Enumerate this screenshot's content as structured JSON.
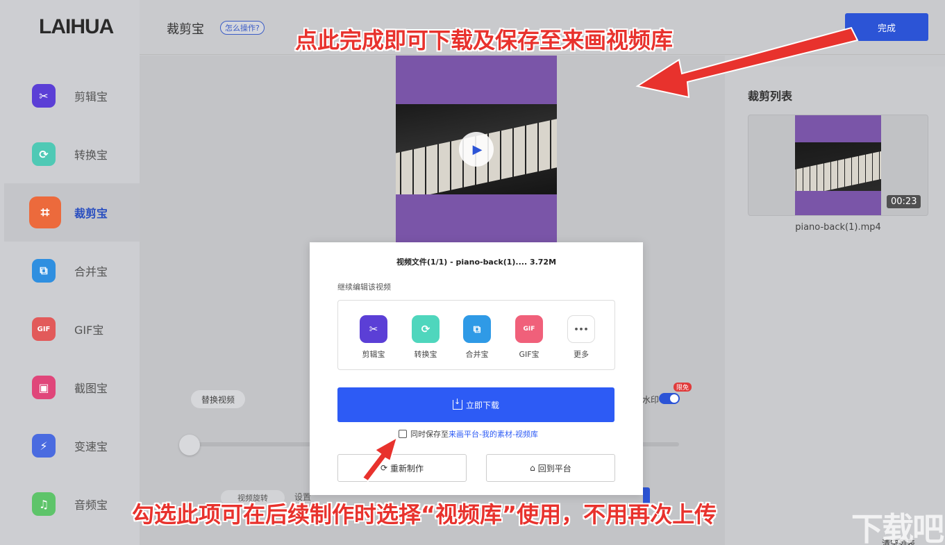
{
  "app": {
    "logo": "LAIHUA"
  },
  "sidebar": {
    "items": [
      {
        "label": "剪辑宝",
        "icon": "scissors-icon",
        "color": "#5b3fd6",
        "glyph": "✂"
      },
      {
        "label": "转换宝",
        "icon": "convert-icon",
        "color": "#4fc9b5",
        "glyph": "⟳"
      },
      {
        "label": "裁剪宝",
        "icon": "crop-icon",
        "color": "#ec6a3c",
        "glyph": "⌗"
      },
      {
        "label": "合并宝",
        "icon": "merge-icon",
        "color": "#2f8fe0",
        "glyph": "⧉"
      },
      {
        "label": "GIF宝",
        "icon": "gif-icon",
        "color": "#e25a5a",
        "glyph": "GIF"
      },
      {
        "label": "截图宝",
        "icon": "screenshot-icon",
        "color": "#e0467a",
        "glyph": "▣"
      },
      {
        "label": "变速宝",
        "icon": "speed-icon",
        "color": "#4a6be0",
        "glyph": "⚡"
      },
      {
        "label": "音频宝",
        "icon": "audio-icon",
        "color": "#5ec46a",
        "glyph": "♫"
      }
    ],
    "active_index": 2
  },
  "header": {
    "title": "裁剪宝",
    "help": "怎么操作?",
    "done_label": "完成"
  },
  "editor": {
    "replace_video": "替换视频",
    "watermark_label": "水印",
    "limited_badge": "限免",
    "rotate_label": "视频旋转",
    "setting_text": "设置"
  },
  "crop_list": {
    "title": "裁剪列表",
    "items": [
      {
        "filename": "piano-back(1).mp4",
        "duration": "00:23"
      }
    ],
    "clear_label": "清空列表"
  },
  "modal": {
    "file_info": "视频文件(1/1) - piano-back(1)....    3.72M",
    "continue_label": "继续编辑该视频",
    "tools": [
      {
        "label": "剪辑宝",
        "icon": "scissors-icon",
        "glyph": "✂",
        "color": "#5b3fd6"
      },
      {
        "label": "转换宝",
        "icon": "convert-icon",
        "glyph": "⟳",
        "color": "#4fd6bd"
      },
      {
        "label": "合并宝",
        "icon": "merge-icon",
        "glyph": "⧉",
        "color": "#2f9ae6"
      },
      {
        "label": "GIF宝",
        "icon": "gif-icon",
        "glyph": "GIF",
        "color": "#f0607a"
      },
      {
        "label": "更多",
        "icon": "more-icon",
        "glyph": "•••",
        "color": "#ffffff"
      }
    ],
    "download_label": "立即下载",
    "save_prefix": "同时保存至",
    "save_link": "来画平台-我的素材-视频库",
    "save_checked": false,
    "remake_label": "重新制作",
    "back_label": "回到平台"
  },
  "annotations": {
    "top": "点此完成即可下载及保存至来画视频库",
    "bottom": "勾选此项可在后续制作时选择“视频库”使用，不用再次上传",
    "color": "#e8322d"
  },
  "watermark_site": "下载吧"
}
